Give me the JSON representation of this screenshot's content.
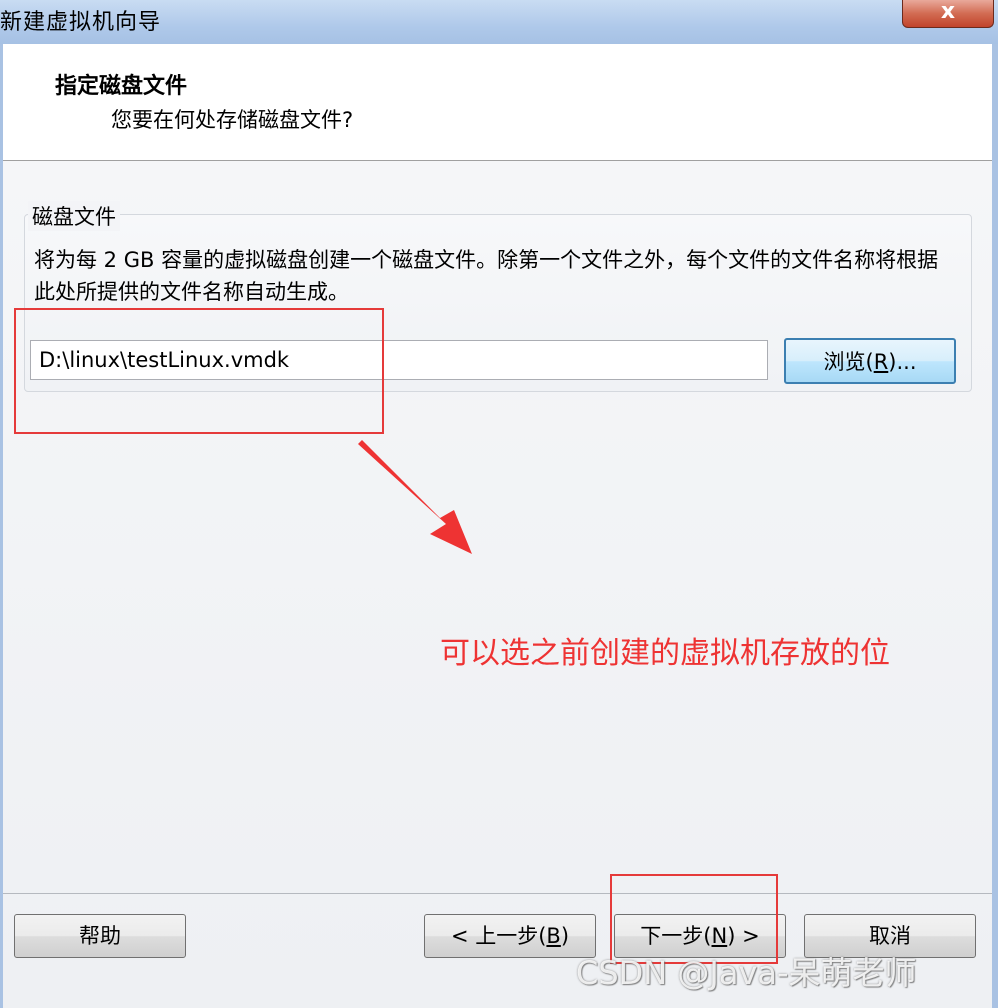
{
  "window": {
    "title": "新建虚拟机向导",
    "close_glyph": "x"
  },
  "header": {
    "title": "指定磁盘文件",
    "subtitle": "您要在何处存储磁盘文件?"
  },
  "disk_group": {
    "label": "磁盘文件",
    "description": "将为每 2 GB 容量的虚拟磁盘创建一个磁盘文件。除第一个文件之外，每个文件的文件名称将根据此处所提供的文件名称自动生成。",
    "path_value": "D:\\linux\\testLinux.vmdk",
    "browse_prefix": "浏览(",
    "browse_key": "R",
    "browse_suffix": ")..."
  },
  "buttons": {
    "help": "帮助",
    "back_prefix": "< 上一步(",
    "back_key": "B",
    "back_suffix": ")",
    "next_prefix": "下一步(",
    "next_key": "N",
    "next_suffix": ") >",
    "cancel": "取消"
  },
  "annotation": {
    "text": "可以选之前创建的虚拟机存放的位",
    "color": "#ee3333"
  },
  "watermark": "CSDN @Java-呆萌老师"
}
